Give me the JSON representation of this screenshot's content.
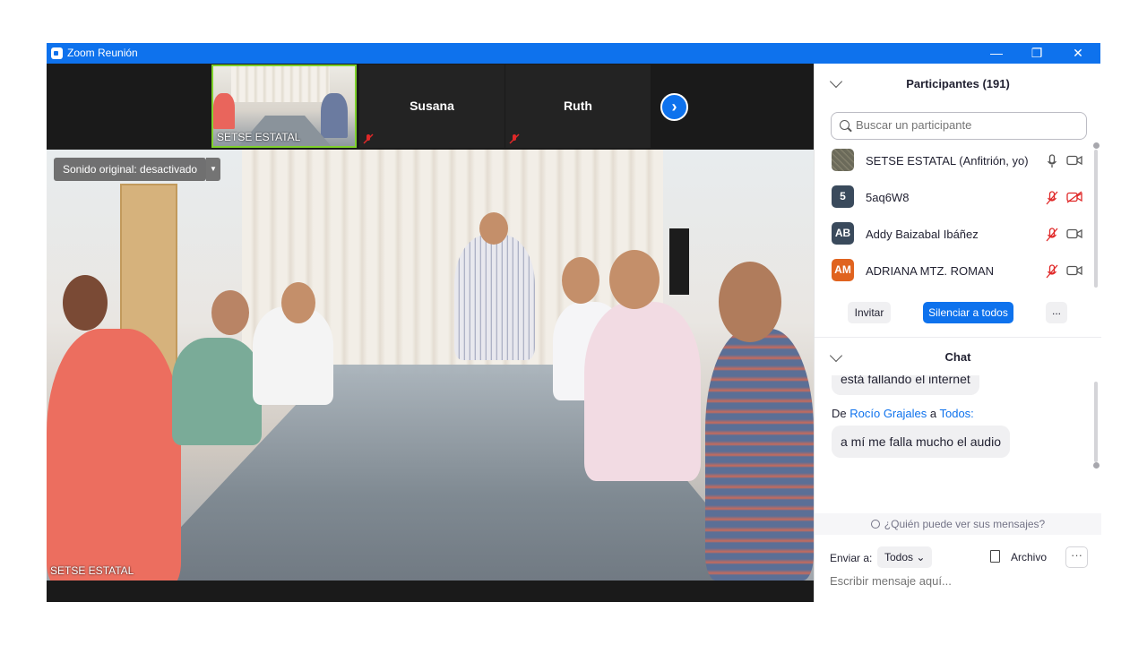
{
  "window": {
    "title": "Zoom Reunión",
    "minimize": "—",
    "restore": "❐",
    "close": "✕"
  },
  "thumbnails": [
    {
      "name": "SETSE ESTATAL",
      "type": "video"
    },
    {
      "name": "Susana",
      "type": "name"
    },
    {
      "name": "Ruth",
      "type": "name"
    }
  ],
  "strip": {
    "next_glyph": "›"
  },
  "main_video": {
    "sound_button": "Sonido original: desactivado",
    "dropdown_glyph": "▼",
    "label": "SETSE ESTATAL"
  },
  "participants": {
    "title": "Participantes (191)",
    "search_placeholder": "Buscar un participante",
    "list": [
      {
        "avatar_text": "",
        "avatar_color": "#6b6a5a",
        "name": "SETSE ESTATAL (Anfitrión, yo)",
        "mic": "on",
        "cam": "on"
      },
      {
        "avatar_text": "5",
        "avatar_color": "#3a4a5c",
        "name": "5aq6W8",
        "mic": "muted",
        "cam": "off"
      },
      {
        "avatar_text": "AB",
        "avatar_color": "#3a4a5c",
        "name": "Addy Baizabal Ibáñez",
        "mic": "muted",
        "cam": "on"
      },
      {
        "avatar_text": "AM",
        "avatar_color": "#e0631f",
        "name": "ADRIANA MTZ. ROMAN",
        "mic": "muted",
        "cam": "on"
      }
    ],
    "invite": "Invitar",
    "mute_all": "Silenciar a todos",
    "more": "..."
  },
  "chat": {
    "title": "Chat",
    "prev_message": "está fallando el internet",
    "from_prefix": "De",
    "sender": "Rocío Grajales",
    "to_word": "a",
    "recipient": "Todos:",
    "message": "a mí me falla mucho el audio",
    "who_can_see": "¿Quién puede ver sus mensajes?",
    "send_to_label": "Enviar a:",
    "send_to_value": "Todos",
    "file_label": "Archivo",
    "more": "···",
    "input_placeholder": "Escribir mensaje aquí..."
  },
  "colors": {
    "zoom_blue": "#0e72ed",
    "muted_red": "#e02828"
  }
}
